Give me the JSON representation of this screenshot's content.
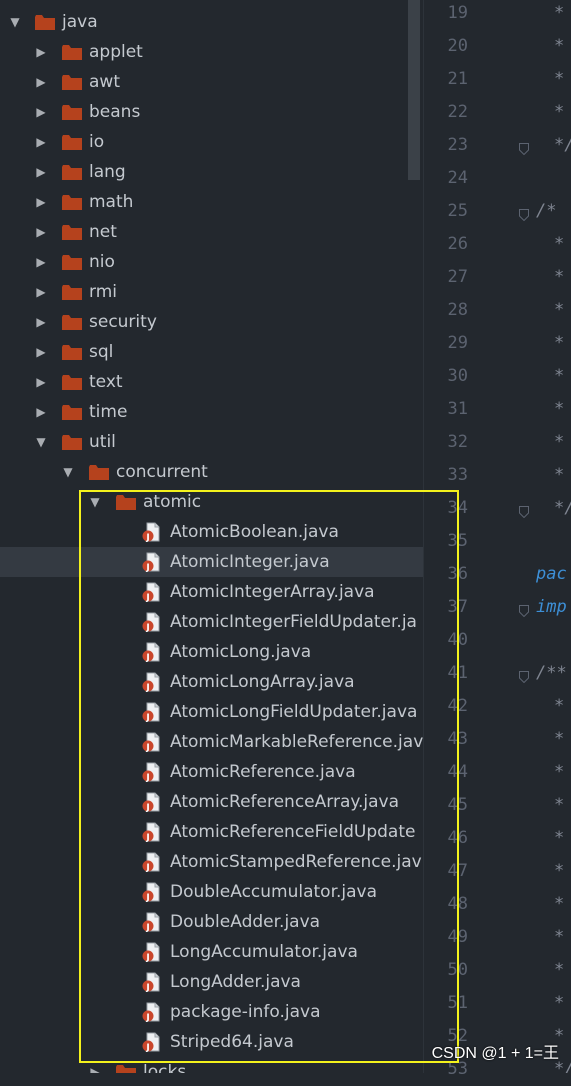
{
  "tree": {
    "root": {
      "label": "java",
      "expanded": true
    },
    "packages": [
      {
        "label": "applet"
      },
      {
        "label": "awt"
      },
      {
        "label": "beans"
      },
      {
        "label": "io"
      },
      {
        "label": "lang"
      },
      {
        "label": "math"
      },
      {
        "label": "net"
      },
      {
        "label": "nio"
      },
      {
        "label": "rmi"
      },
      {
        "label": "security"
      },
      {
        "label": "sql"
      },
      {
        "label": "text"
      },
      {
        "label": "time"
      }
    ],
    "util": {
      "label": "util",
      "expanded": true
    },
    "concurrent": {
      "label": "concurrent",
      "expanded": true
    },
    "atomic": {
      "label": "atomic",
      "expanded": true
    },
    "files": [
      {
        "label": "AtomicBoolean.java"
      },
      {
        "label": "AtomicInteger.java",
        "selected": true
      },
      {
        "label": "AtomicIntegerArray.java"
      },
      {
        "label": "AtomicIntegerFieldUpdater.ja"
      },
      {
        "label": "AtomicLong.java"
      },
      {
        "label": "AtomicLongArray.java"
      },
      {
        "label": "AtomicLongFieldUpdater.java"
      },
      {
        "label": "AtomicMarkableReference.jav"
      },
      {
        "label": "AtomicReference.java"
      },
      {
        "label": "AtomicReferenceArray.java"
      },
      {
        "label": "AtomicReferenceFieldUpdate"
      },
      {
        "label": "AtomicStampedReference.jav"
      },
      {
        "label": "DoubleAccumulator.java"
      },
      {
        "label": "DoubleAdder.java"
      },
      {
        "label": "LongAccumulator.java"
      },
      {
        "label": "LongAdder.java"
      },
      {
        "label": "package-info.java"
      },
      {
        "label": "Striped64.java"
      }
    ],
    "partial": {
      "label": "locks"
    }
  },
  "editor": {
    "line_numbers": [
      "19",
      "20",
      "21",
      "22",
      "23",
      "24",
      "25",
      "26",
      "27",
      "28",
      "29",
      "30",
      "31",
      "32",
      "33",
      "34",
      "35",
      "36",
      "37",
      "40",
      "41",
      "42",
      "43",
      "44",
      "45",
      "46",
      "47",
      "48",
      "49",
      "50",
      "51",
      "52",
      "53"
    ],
    "code_lines": [
      "*",
      "*",
      "*",
      "*",
      "*/",
      "",
      "/*",
      "*",
      "*",
      "*",
      "*",
      "*",
      "*",
      "*",
      "*",
      "*/",
      "",
      "pac",
      "imp",
      "",
      "/**",
      "*",
      "*",
      "*",
      "*",
      "*",
      "*",
      "*",
      "*",
      "*",
      "*",
      "*",
      "*/"
    ]
  },
  "colors": {
    "background": "#23282e",
    "folder": "#b5421d",
    "highlight_border": "#f4f21c",
    "keyword": "#3d8fd6"
  },
  "icons": {
    "expanded": "triangle-down-icon",
    "collapsed": "triangle-right-icon",
    "folder": "folder-icon",
    "java_file": "java-file-icon"
  },
  "watermark": "CSDN @1 + 1=王"
}
